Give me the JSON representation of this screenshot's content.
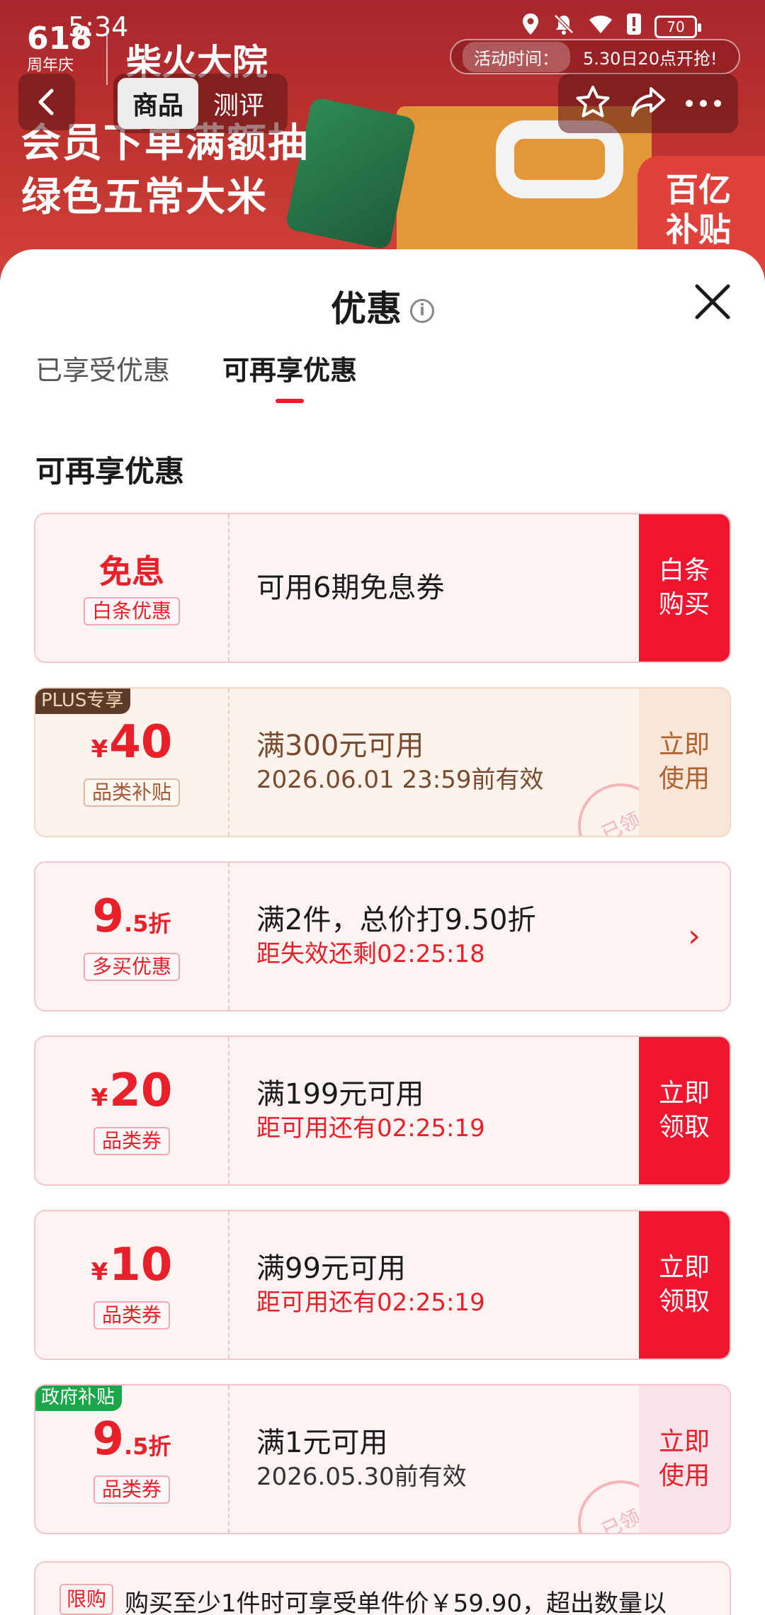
{
  "status_bar": {
    "time": "5:34",
    "battery": "70"
  },
  "banner": {
    "logo_618": "618",
    "logo_618_sub": "周年庆",
    "brand": "柴火大院",
    "slogan_line1": "会员下单满额抽",
    "slogan_line2": "绿色五常大米",
    "event_time_label": "活动时间：",
    "event_time_value": "5.30日20点开抢!",
    "subsidy_badge_line1": "百亿",
    "subsidy_badge_line2": "补贴"
  },
  "nav": {
    "tabs": [
      {
        "label": "商品",
        "active": true
      },
      {
        "label": "测评",
        "active": false
      }
    ]
  },
  "sheet": {
    "title": "优惠",
    "tabs": [
      {
        "label": "已享受优惠",
        "active": false
      },
      {
        "label": "可再享优惠",
        "active": true
      }
    ],
    "section_title": "可再享优惠"
  },
  "coupons": [
    {
      "value": "免息",
      "tag": "白条优惠",
      "main": "可用6期免息券",
      "button": "白条购买"
    },
    {
      "corner": "PLUS专享",
      "currency": "¥",
      "value": "40",
      "tag": "品类补贴",
      "main": "满300元可用",
      "sub": "2026.06.01 23:59前有效",
      "button": "立即使用",
      "stamp": "已领"
    },
    {
      "value": "9",
      "unit": ".5折",
      "tag": "多买优惠",
      "main": "满2件，总价打9.50折",
      "sub": "距失效还剩02:25:18",
      "button": "›"
    },
    {
      "currency": "¥",
      "value": "20",
      "tag": "品类券",
      "main": "满199元可用",
      "sub": "距可用还有02:25:19",
      "button": "立即领取"
    },
    {
      "currency": "¥",
      "value": "10",
      "tag": "品类券",
      "main": "满99元可用",
      "sub": "距可用还有02:25:19",
      "button": "立即领取"
    },
    {
      "corner": "政府补贴",
      "value": "9",
      "unit": ".5折",
      "tag": "品类券",
      "main": "满1元可用",
      "sub": "2026.05.30前有效",
      "button": "立即使用",
      "stamp": "已领"
    }
  ],
  "limit_notice": {
    "badge": "限购",
    "text": "购买至少1件时可享受单件价￥59.90，超出数量以"
  },
  "colors": {
    "accent": "#e8202a",
    "button_red": "#f01630",
    "plus_brown": "#5b3b2a",
    "gov_green": "#19a74a"
  }
}
